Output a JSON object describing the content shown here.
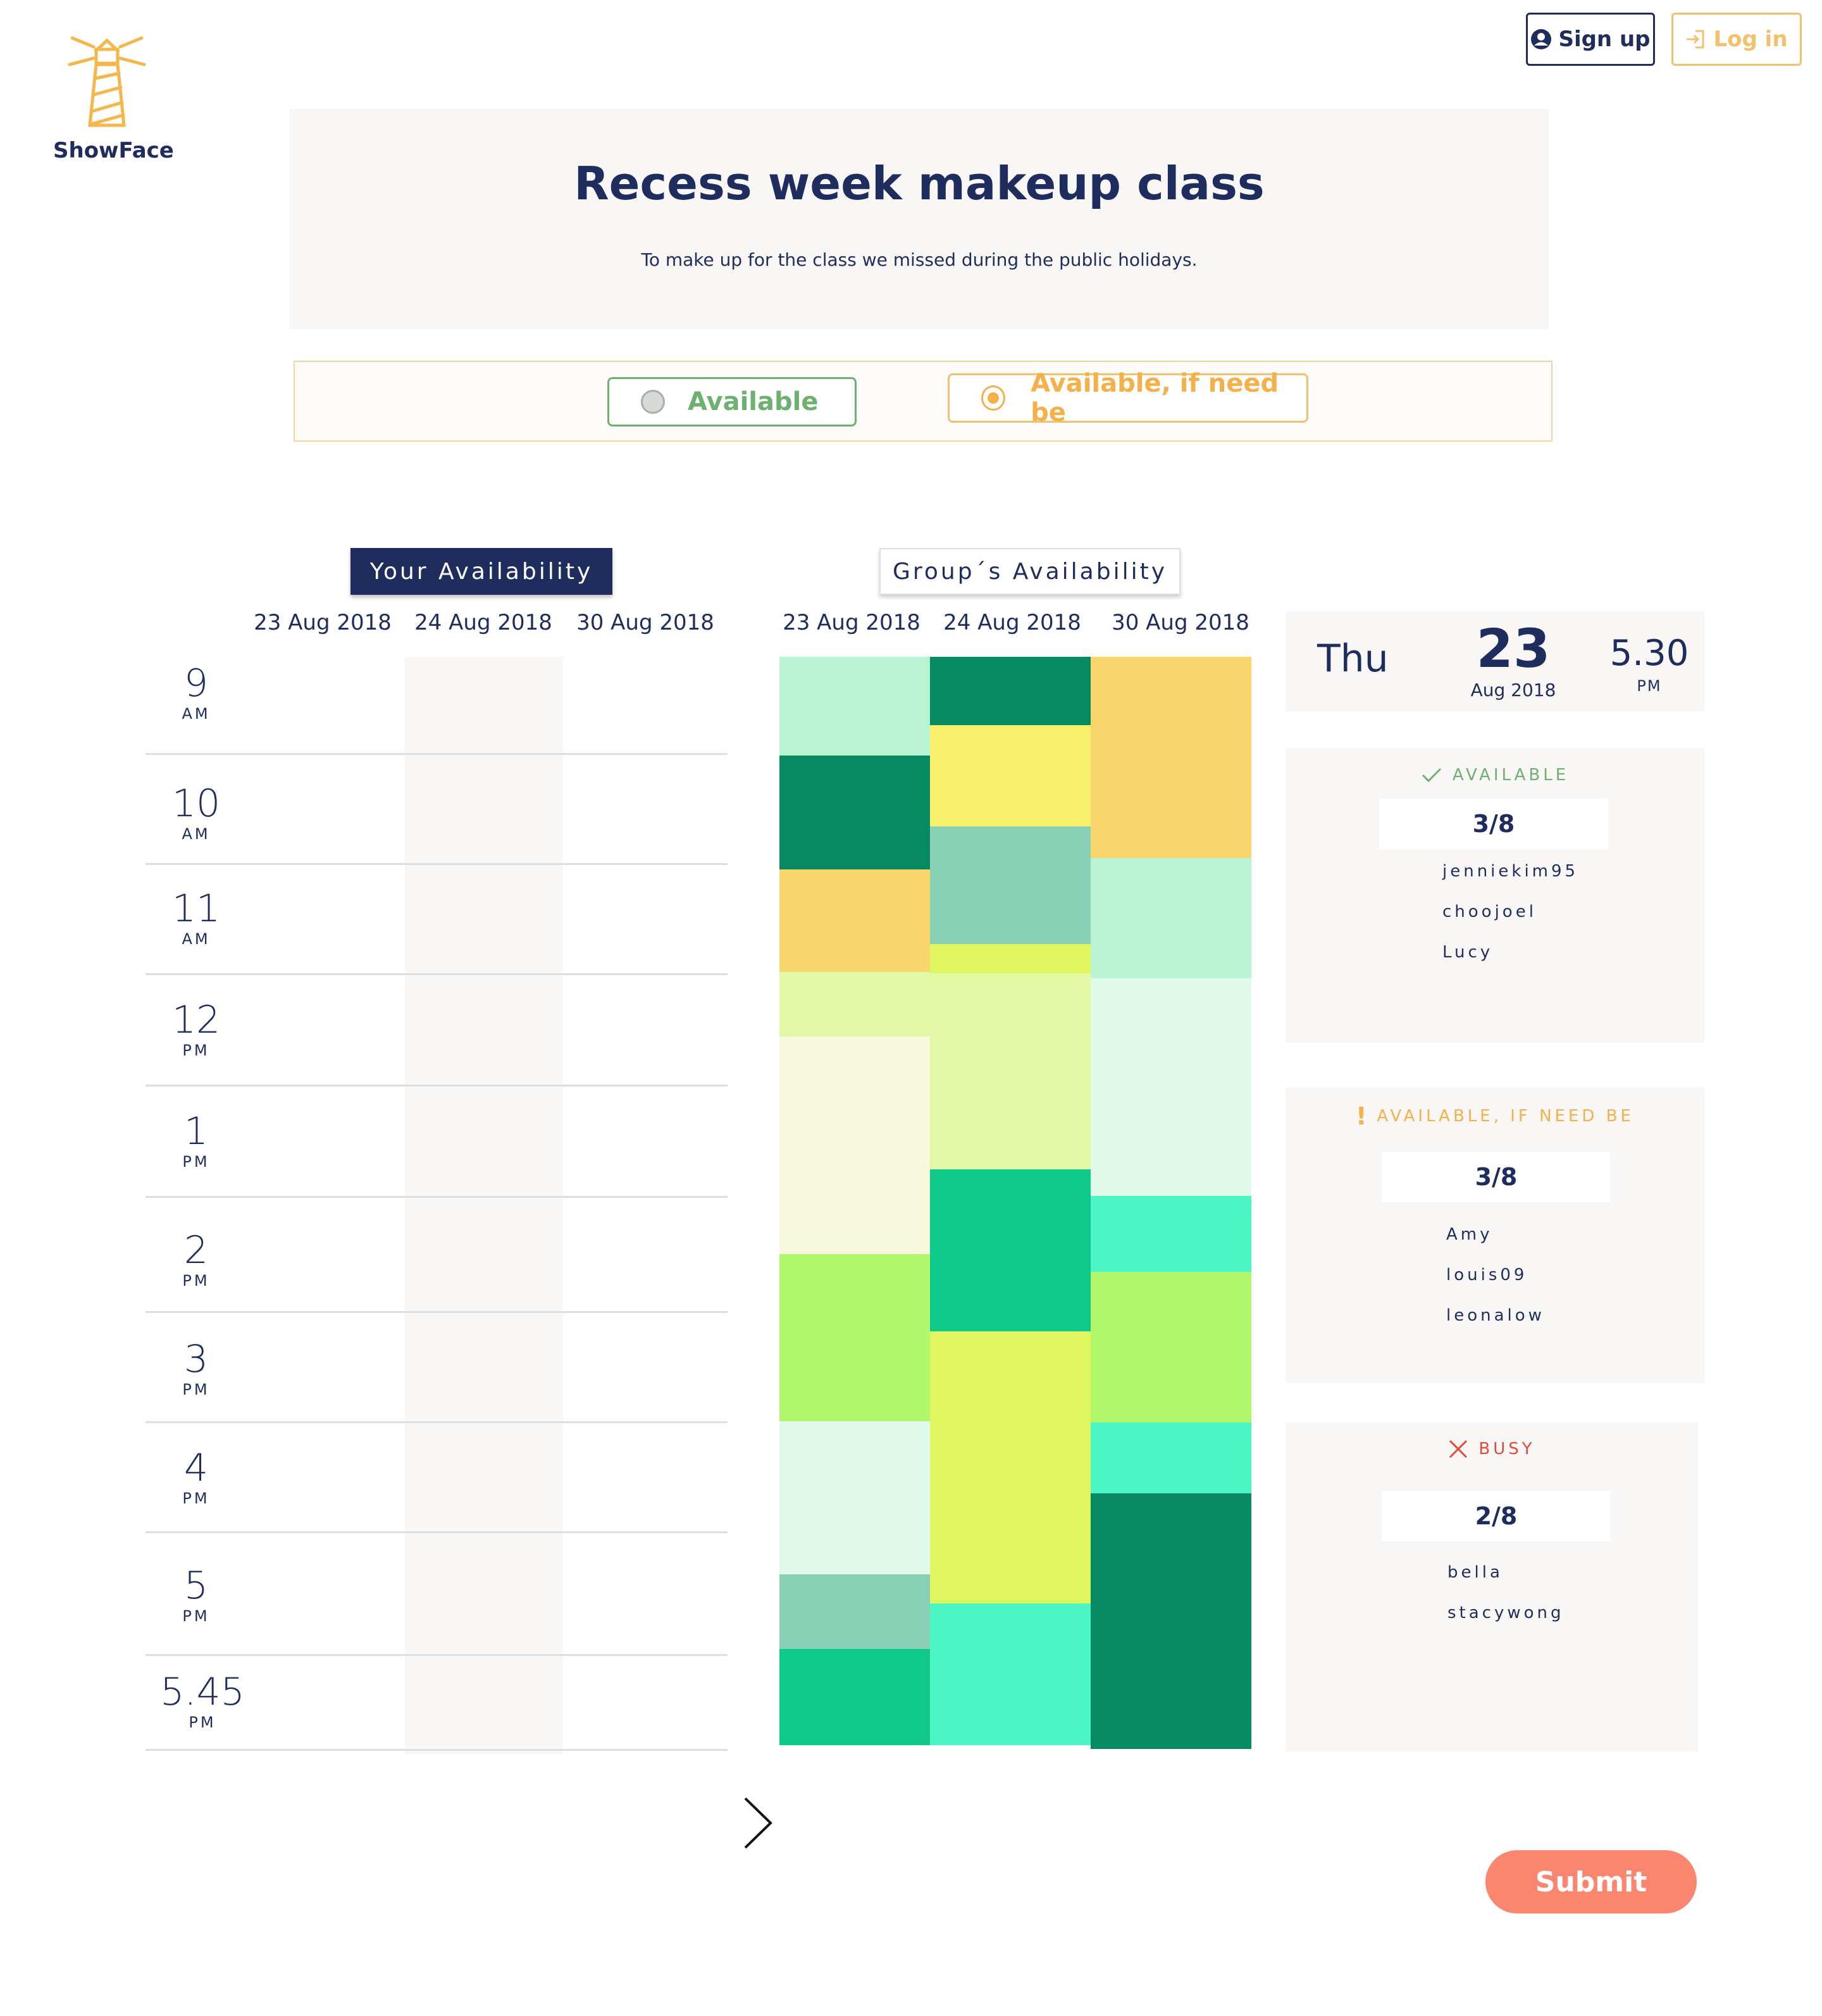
{
  "brand": {
    "name": "ShowFace"
  },
  "auth": {
    "signup_label": "Sign up",
    "login_label": "Log in"
  },
  "event": {
    "title": "Recess week makeup class",
    "description": "To make up for the class we missed during the public holidays."
  },
  "legend": {
    "available_label": "Available",
    "if_need_be_label": "Available, if need be"
  },
  "tabs": {
    "your_label": "Your Availability",
    "group_label": "Group´s Availability"
  },
  "dates": [
    "23 Aug 2018",
    "24 Aug 2018",
    "30 Aug 2018"
  ],
  "times": [
    {
      "h": "9",
      "ap": "AM"
    },
    {
      "h": "10",
      "ap": "AM"
    },
    {
      "h": "11",
      "ap": "AM"
    },
    {
      "h": "12",
      "ap": "PM"
    },
    {
      "h": "1",
      "ap": "PM"
    },
    {
      "h": "2",
      "ap": "PM"
    },
    {
      "h": "3",
      "ap": "PM"
    },
    {
      "h": "4",
      "ap": "PM"
    },
    {
      "h": "5",
      "ap": "PM"
    },
    {
      "h": "5.45",
      "ap": "PM"
    }
  ],
  "heatmap_colors": {
    "light_mint": "#b8f4d3",
    "dark_green": "#078a62",
    "teal_green": "#0fc98b",
    "aqua": "#4cf5c4",
    "sage": "#88d1b7",
    "yellow_orange": "#f8d66b",
    "yellow": "#f8f06b",
    "lime_yellow": "#e0f65e",
    "lime": "#b0f76b",
    "pale_lime": "#e3f8a5",
    "pale_cream": "#f8f8dc",
    "pale_mint": "#dff9ea"
  },
  "selected_slot": {
    "day": "Thu",
    "date": "23",
    "month_year": "Aug 2018",
    "time": "5.30",
    "ampm": "PM"
  },
  "panels": {
    "available": {
      "title": "AVAILABLE",
      "count": "3/8",
      "names": [
        "jenniekim95",
        "choojoel",
        "Lucy"
      ],
      "color": "#6eb06f"
    },
    "if_need_be": {
      "title": "AVAILABLE, IF NEED BE",
      "count": "3/8",
      "names": [
        "Amy",
        "louis09",
        "leonalow"
      ],
      "color": "#f5b04a"
    },
    "busy": {
      "title": "BUSY",
      "count": "2/8",
      "names": [
        "bella",
        "stacywong"
      ],
      "color": "#e04b3c"
    }
  },
  "submit_label": "Submit"
}
